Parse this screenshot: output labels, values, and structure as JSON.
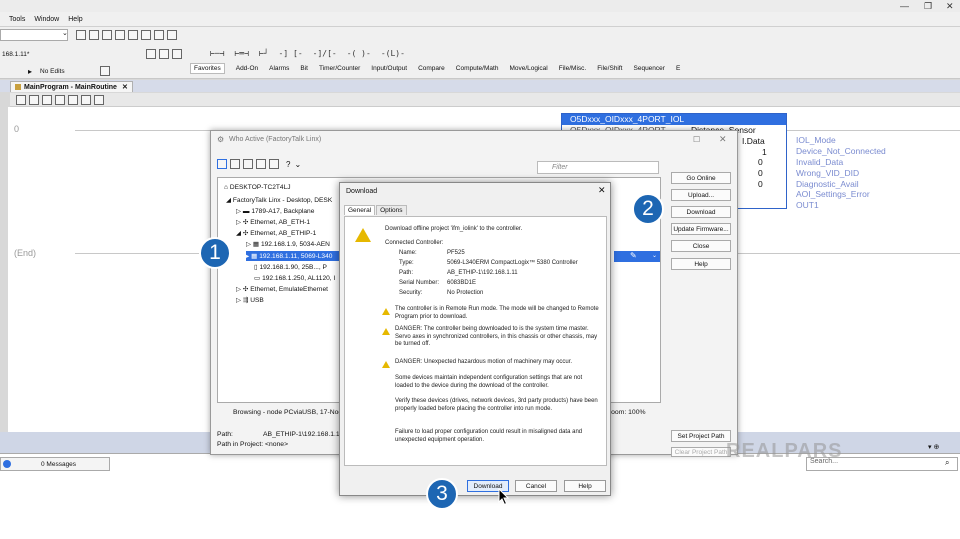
{
  "menu": [
    "Tools",
    "Window",
    "Help"
  ],
  "toolbar": {
    "path_value": "168.1.11*",
    "mode_status": "No Edits"
  },
  "instruction_tabs": [
    "Favorites",
    "Add-On",
    "Alarms",
    "Bit",
    "Timer/Counter",
    "Input/Output",
    "Compare",
    "Compute/Math",
    "Move/Logical",
    "File/Misc.",
    "File/Shift",
    "Sequencer",
    "E"
  ],
  "document_tab": "MainProgram - MainRoutine",
  "ladder": {
    "rung0": "0",
    "end": "(End)",
    "aoi_header": "O5Dxxx_OIDxxx_4PORT_IOL",
    "aoi_sub": "O5Dxxx_OIDxxx_4PORT",
    "aoi_sub_right": "Distance_Sensor",
    "data_label": "I.Data",
    "values": [
      "1",
      "0",
      "0",
      "0"
    ],
    "outputs": [
      "IOL_Mode",
      "Device_Not_Connected",
      "Invalid_Data",
      "Wrong_VID_DID",
      "Diagnostic_Avail",
      "AOI_Settings_Error",
      "OUT1"
    ]
  },
  "bottom": {
    "messages": "0 Messages",
    "search_placeholder": "Search..."
  },
  "who_active": {
    "title": "Who Active (FactoryTalk Linx)",
    "filter_placeholder": "Filter",
    "tree": [
      "DESKTOP-TC2T4LJ",
      "FactoryTalk Linx - Desktop, DESK",
      "1789-A17, Backplane",
      "Ethernet, AB_ETH-1",
      "Ethernet, AB_ETHIP-1",
      "192.168.1.9, 5034-AEN",
      "192.168.1.11, 5069-L340",
      "192.168.1.90, 25B..., P",
      "192.168.1.250, AL1120, I",
      "Ethernet, EmulateEthernet",
      "USB"
    ],
    "status": "Browsing - node PCviaUSB, 17-Node",
    "zoom": "Zoom: 100%",
    "path_label": "Path:",
    "path_value": "AB_ETHIP-1\\192.168.1.11",
    "path_in_project": "Path in Project: <none>",
    "buttons": [
      "Go Online",
      "Upload...",
      "Download",
      "Update Firmware...",
      "Close",
      "Help"
    ],
    "set_project_path": "Set Project Path",
    "clear_project_path": "Clear Project Path"
  },
  "download_dialog": {
    "title": "Download",
    "tabs": [
      "General",
      "Options"
    ],
    "intro": "Download offline project 'ifm_iolink' to the controller.",
    "connected_controller": "Connected Controller:",
    "fields": [
      {
        "label": "Name:",
        "value": "PF525"
      },
      {
        "label": "Type:",
        "value": "5069-L340ERM CompactLogix™ 5380 Controller"
      },
      {
        "label": "Path:",
        "value": "AB_ETHIP-1\\192.168.1.11"
      },
      {
        "label": "Serial Number:",
        "value": "6083BD1E"
      },
      {
        "label": "Security:",
        "value": "No Protection"
      }
    ],
    "warning1": "The controller is in Remote Run mode. The mode will be changed to Remote Program prior to download.",
    "warning2": "DANGER: The controller being downloaded to is the system time master. Servo axes in synchronized controllers, in this chassis or other chassis, may be turned off.",
    "warning3": "DANGER: Unexpected hazardous motion of machinery may occur.",
    "note1": "Some devices maintain independent configuration settings that are not loaded to the device during the download of the controller.",
    "note2": "Verify these devices (drives, network devices, 3rd party products) have been properly loaded before placing the controller into run mode.",
    "note3": "Failure to load proper configuration could result in misaligned data and unexpected equipment operation.",
    "buttons": [
      "Download",
      "Cancel",
      "Help"
    ]
  },
  "callouts": [
    "1",
    "2",
    "3"
  ],
  "watermark": "REALPARS",
  "colors": {
    "selection": "#2f6fe0",
    "callout": "#1d66b3",
    "warning": "#e6b800"
  }
}
